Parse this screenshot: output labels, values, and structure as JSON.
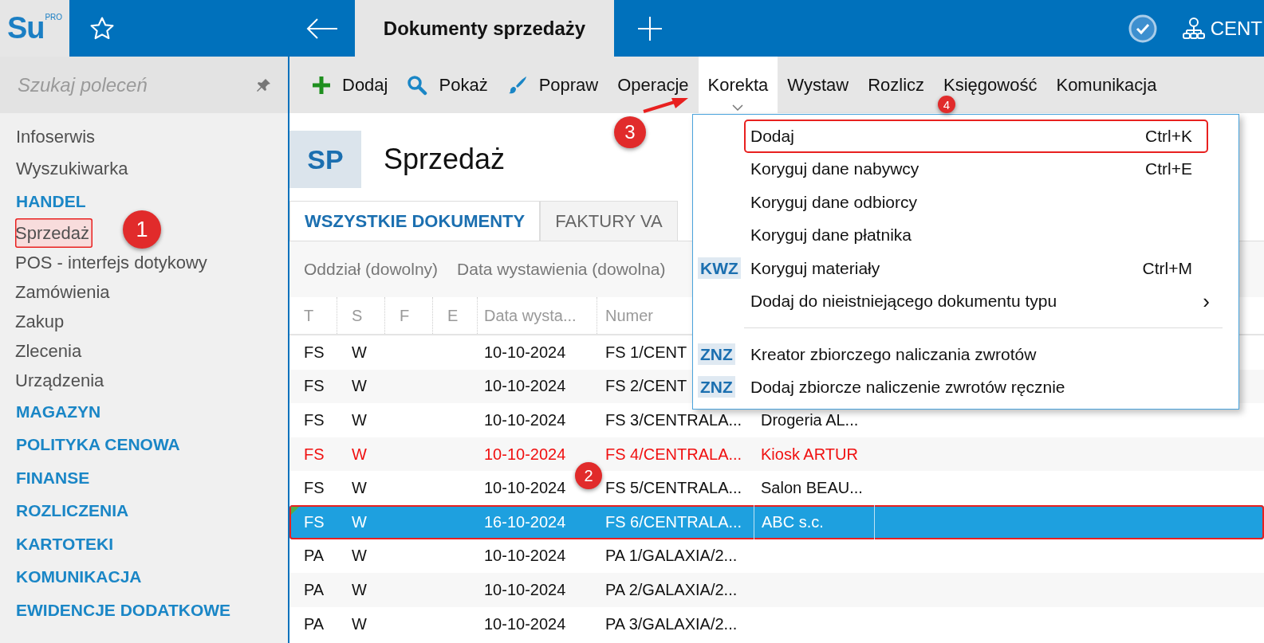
{
  "app": {
    "logo": "Su",
    "logo_badge": "PRO",
    "user_label": "CENT"
  },
  "tabs": [
    {
      "label": "Dokumenty sprzedaży",
      "selected": true
    }
  ],
  "sidebar": {
    "search": {
      "placeholder": "Szukaj poleceń"
    },
    "items": [
      {
        "label": "Infoserwis",
        "kind": "link",
        "selected": false
      },
      {
        "label": "Wyszukiwarka",
        "kind": "link",
        "selected": false
      },
      {
        "label": "HANDEL",
        "kind": "section",
        "selected": false,
        "children": [
          {
            "label": "Sprzedaż",
            "kind": "link",
            "selected": true,
            "highlighted": true
          },
          {
            "label": "POS - interfejs dotykowy",
            "kind": "link",
            "selected": false
          },
          {
            "label": "Zamówienia",
            "kind": "link",
            "selected": false
          },
          {
            "label": "Zakup",
            "kind": "link",
            "selected": false
          },
          {
            "label": "Zlecenia",
            "kind": "link",
            "selected": false
          },
          {
            "label": "Urządzenia",
            "kind": "link",
            "selected": false
          }
        ]
      },
      {
        "label": "MAGAZYN",
        "kind": "section",
        "selected": false
      },
      {
        "label": "POLITYKA CENOWA",
        "kind": "section",
        "selected": false
      },
      {
        "label": "FINANSE",
        "kind": "section",
        "selected": false
      },
      {
        "label": "ROZLICZENIA",
        "kind": "section",
        "selected": false
      },
      {
        "label": "KARTOTEKI",
        "kind": "section",
        "selected": false
      },
      {
        "label": "KOMUNIKACJA",
        "kind": "section",
        "selected": false
      },
      {
        "label": "EWIDENCJE DODATKOWE",
        "kind": "section",
        "selected": false
      }
    ]
  },
  "toolbar": [
    {
      "label": "Dodaj",
      "selected": false
    },
    {
      "label": "Pokaż",
      "selected": false
    },
    {
      "label": "Popraw",
      "selected": false
    },
    {
      "label": "Operacje",
      "selected": false
    },
    {
      "label": "Korekta",
      "selected": true,
      "expanded": true
    },
    {
      "label": "Wystaw",
      "selected": false
    },
    {
      "label": "Rozlicz",
      "selected": false
    },
    {
      "label": "Księgowość",
      "selected": false
    },
    {
      "label": "Komunikacja",
      "selected": false
    }
  ],
  "page": {
    "badge": "SP",
    "title": "Sprzedaż"
  },
  "view_tabs": [
    {
      "label": "WSZYSTKIE DOKUMENTY",
      "selected": true
    },
    {
      "label": "FAKTURY VA",
      "selected": false
    }
  ],
  "filters": [
    "Oddział (dowolny)",
    "Data wystawienia (dowolna)"
  ],
  "table": {
    "columns": [
      "T",
      "S",
      "F",
      "E",
      "Data wysta...",
      "Numer"
    ],
    "rows": [
      {
        "cells": [
          "FS",
          "W",
          "",
          "",
          "10-10-2024",
          "FS 1/CENT",
          ""
        ],
        "selected": false,
        "flagged": false
      },
      {
        "cells": [
          "FS",
          "W",
          "",
          "",
          "10-10-2024",
          "FS 2/CENT",
          ""
        ],
        "selected": false,
        "flagged": false
      },
      {
        "cells": [
          "FS",
          "W",
          "",
          "",
          "10-10-2024",
          "FS 3/CENTRALA...",
          "Drogeria AL..."
        ],
        "selected": false,
        "flagged": false
      },
      {
        "cells": [
          "FS",
          "W",
          "",
          "",
          "10-10-2024",
          "FS 4/CENTRALA...",
          "Kiosk ARTUR"
        ],
        "selected": false,
        "flagged": true
      },
      {
        "cells": [
          "FS",
          "W",
          "",
          "",
          "10-10-2024",
          "FS 5/CENTRALA...",
          "Salon BEAU..."
        ],
        "selected": false,
        "flagged": false
      },
      {
        "cells": [
          "FS",
          "W",
          "",
          "",
          "16-10-2024",
          "FS 6/CENTRALA...",
          "ABC s.c."
        ],
        "selected": true,
        "flagged": false
      },
      {
        "cells": [
          "PA",
          "W",
          "",
          "",
          "10-10-2024",
          "PA 1/GALAXIA/2...",
          ""
        ],
        "selected": false,
        "flagged": false
      },
      {
        "cells": [
          "PA",
          "W",
          "",
          "",
          "10-10-2024",
          "PA 2/GALAXIA/2...",
          ""
        ],
        "selected": false,
        "flagged": false
      },
      {
        "cells": [
          "PA",
          "W",
          "",
          "",
          "10-10-2024",
          "PA 3/GALAXIA/2...",
          ""
        ],
        "selected": false,
        "flagged": false
      }
    ]
  },
  "menu": {
    "items": [
      {
        "kind": "item",
        "label": "Dodaj",
        "shortcut": "Ctrl+K",
        "highlighted": true
      },
      {
        "kind": "item",
        "label": "Koryguj dane nabywcy",
        "shortcut": "Ctrl+E",
        "highlighted": false
      },
      {
        "kind": "item",
        "label": "Koryguj dane odbiorcy",
        "highlighted": false
      },
      {
        "kind": "item",
        "label": "Koryguj dane płatnika",
        "highlighted": false
      },
      {
        "kind": "item",
        "badge": "KWZ",
        "label": "Koryguj materiały",
        "shortcut": "Ctrl+M",
        "highlighted": false
      },
      {
        "kind": "submenu",
        "label": "Dodaj do nieistniejącego dokumentu typu",
        "arrow": "›",
        "highlighted": false
      },
      {
        "kind": "separator"
      },
      {
        "kind": "item",
        "badge": "ZNZ",
        "label": "Kreator zbiorczego naliczania zwrotów",
        "highlighted": false
      },
      {
        "kind": "item",
        "badge": "ZNZ",
        "label": "Dodaj zbiorcze naliczenie zwrotów ręcznie",
        "highlighted": false
      }
    ]
  },
  "annotations": [
    {
      "label": "1"
    },
    {
      "label": "2"
    },
    {
      "label": "3",
      "arrow": true
    },
    {
      "label": "4"
    }
  ]
}
